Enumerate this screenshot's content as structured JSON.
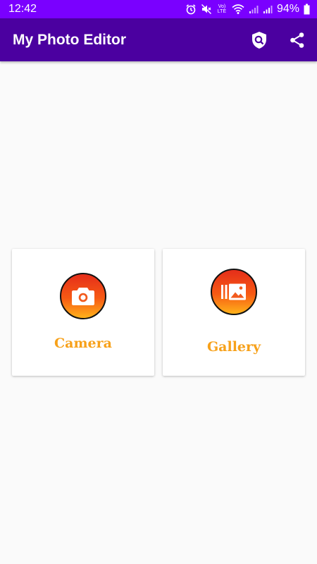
{
  "status_bar": {
    "time": "12:42",
    "battery": "94%",
    "network_label": "Vo) LTE",
    "icons": [
      "alarm-icon",
      "mute-icon",
      "volte-icon",
      "wifi-icon",
      "signal-icon",
      "signal-icon",
      "battery-icon"
    ]
  },
  "app_bar": {
    "title": "My Photo Editor",
    "actions": [
      "privacy-shield-icon",
      "share-icon"
    ]
  },
  "cards": [
    {
      "label": "Camera",
      "icon": "camera-icon"
    },
    {
      "label": "Gallery",
      "icon": "gallery-icon"
    }
  ],
  "colors": {
    "status_bar": "#7a00ff",
    "app_bar": "#4b00a0",
    "label": "#f7a11a",
    "icon_gradient_top": "#e52e1a",
    "icon_gradient_bottom": "#ffb21a",
    "background": "#fafafa"
  }
}
